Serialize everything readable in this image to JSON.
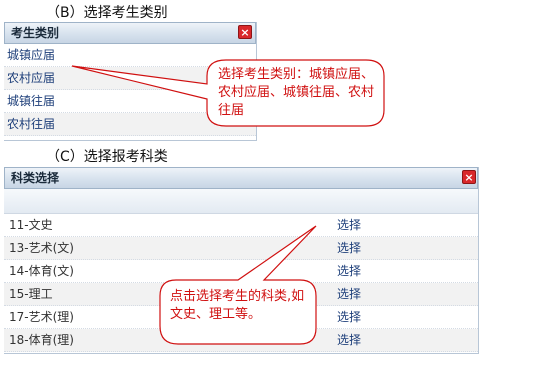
{
  "captions": {
    "b": "（B）选择考生类别",
    "c": "（C）选择报考科类"
  },
  "panelB": {
    "title": "考生类别",
    "close": "×",
    "items": [
      "城镇应届",
      "农村应届",
      "城镇往届",
      "农村往届"
    ]
  },
  "panelC": {
    "title": "科类选择",
    "close": "×",
    "rows": [
      {
        "name": "11-文史",
        "action": "选择"
      },
      {
        "name": "13-艺术(文)",
        "action": "选择"
      },
      {
        "name": "14-体育(文)",
        "action": "选择"
      },
      {
        "name": "15-理工",
        "action": "选择"
      },
      {
        "name": "17-艺术(理)",
        "action": "选择"
      },
      {
        "name": "18-体育(理)",
        "action": "选择"
      }
    ]
  },
  "callouts": {
    "b": "选择考生类别：城镇应届、农村应届、城镇往届、农村往届",
    "c": "点击选择考生的科类,如文史、理工等。"
  },
  "colors": {
    "accent_red": "#d01010",
    "link_blue": "#1e3f7a",
    "close_red": "#d9282b"
  }
}
